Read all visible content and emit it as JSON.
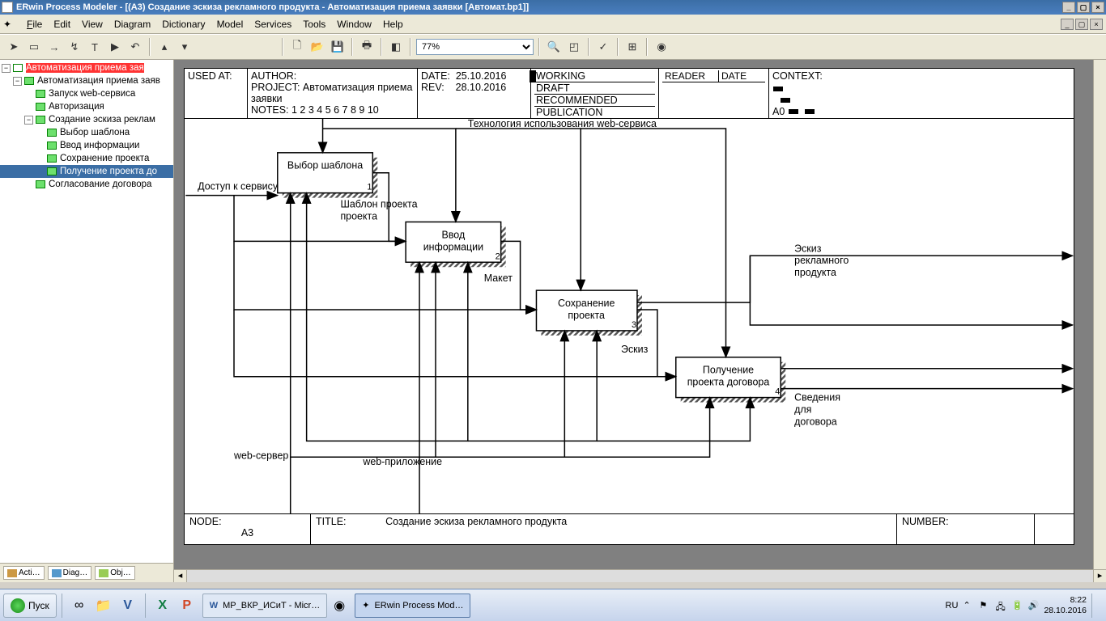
{
  "window": {
    "title": "ERwin Process Modeler - [(A3) Создание эскиза рекламного продукта - Автоматизация приема заявки  [Автомат.bp1]]"
  },
  "menu": {
    "file": "File",
    "edit": "Edit",
    "view": "View",
    "diagram": "Diagram",
    "dictionary": "Dictionary",
    "model": "Model",
    "services": "Services",
    "tools": "Tools",
    "window": "Window",
    "help": "Help"
  },
  "zoom": "77%",
  "tree": {
    "root": "Автоматизация приема зая",
    "n1": "Автоматизация приема  заяв",
    "n11": "Запуск  web-сервиса",
    "n12": "Авторизация",
    "n13": "Создание эскиза реклам",
    "n131": "Выбор шаблона",
    "n132": "Ввод  информации",
    "n133": "Сохранение проекта",
    "n134": "Получение проекта до",
    "n14": "Согласование договора"
  },
  "left_tabs": {
    "t1": "Acti…",
    "t2": "Diag…",
    "t3": "Obj…"
  },
  "idef_header": {
    "used_at": "USED AT:",
    "author_lbl": "AUTHOR:",
    "project_lbl": "PROJECT:",
    "project_val": "Автоматизация приема заявки",
    "notes": "NOTES:  1  2  3  4  5  6  7  8  9  10",
    "date_lbl": "DATE:",
    "date_val": "25.10.2016",
    "rev_lbl": "REV:",
    "rev_val": "28.10.2016",
    "working": "WORKING",
    "draft": "DRAFT",
    "recommended": "RECOMMENDED",
    "publication": "PUBLICATION",
    "reader": "READER",
    "date2": "DATE",
    "context": "CONTEXT:",
    "context_node": "A0"
  },
  "idef_footer": {
    "node_lbl": "NODE:",
    "node_val": "A3",
    "title_lbl": "TITLE:",
    "title_val": "Создание эскиза рекламного продукта",
    "number_lbl": "NUMBER:"
  },
  "activities": {
    "a1": {
      "name": "Выбор шаблона",
      "num": "1"
    },
    "a2": {
      "name1": "Ввод",
      "name2": "информации",
      "num": "2"
    },
    "a3": {
      "name1": "Сохранение",
      "name2": "проекта",
      "num": "3"
    },
    "a4": {
      "name1": "Получение",
      "name2": "проекта договора",
      "num": "4"
    }
  },
  "arrows": {
    "top": "Технология использования web-сервиса",
    "left": "Доступ к сервису",
    "a1out": "Шаблон проекта",
    "a2out": "Макет",
    "a3out": "Эскиз",
    "out1a": "Эскиз",
    "out1b": "рекламного",
    "out1c": "продукта",
    "out2a": "Сведения",
    "out2b": "для",
    "out2c": "договора",
    "mech1": "web-сервер",
    "mech2": "web-приложение"
  },
  "taskbar": {
    "start": "Пуск",
    "word_doc": "МР_ВКР_ИСиТ - Micr…",
    "erwin": "ERwin Process Mod…",
    "lang": "RU",
    "time": "8:22",
    "date": "28.10.2016"
  }
}
